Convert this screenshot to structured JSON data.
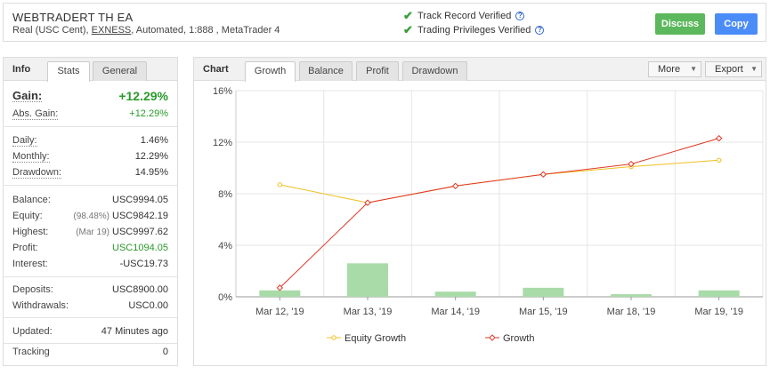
{
  "header": {
    "title": "WEBTRADERT TH EA",
    "subtitle_prefix": "Real (USC Cent), ",
    "broker": "EXNESS",
    "subtitle_suffix": ", Automated, 1:888 , MetaTrader 4",
    "verify1": "Track Record Verified",
    "verify2": "Trading Privileges Verified",
    "discuss_label": "Discuss",
    "copy_label": "Copy"
  },
  "left": {
    "title": "Info",
    "tabs": [
      "Stats",
      "General"
    ],
    "gain": {
      "label": "Gain:",
      "value": "+12.29%"
    },
    "abs_gain": {
      "label": "Abs. Gain:",
      "value": "+12.29%"
    },
    "daily": {
      "label": "Daily:",
      "value": "1.46%"
    },
    "monthly": {
      "label": "Monthly:",
      "value": "12.29%"
    },
    "drawdown": {
      "label": "Drawdown:",
      "value": "14.95%"
    },
    "balance": {
      "label": "Balance:",
      "value": "USC9994.05"
    },
    "equity": {
      "label": "Equity:",
      "note": "(98.48%)",
      "value": "USC9842.19"
    },
    "highest": {
      "label": "Highest:",
      "note": "(Mar 19)",
      "value": "USC9997.62"
    },
    "profit": {
      "label": "Profit:",
      "value": "USC1094.05"
    },
    "interest": {
      "label": "Interest:",
      "value": "-USC19.73"
    },
    "deposits": {
      "label": "Deposits:",
      "value": "USC8900.00"
    },
    "withdrawals": {
      "label": "Withdrawals:",
      "value": "USC0.00"
    },
    "updated": {
      "label": "Updated:",
      "value": "47 Minutes ago"
    },
    "tracking": {
      "label": "Tracking",
      "value": "0"
    }
  },
  "right": {
    "title": "Chart",
    "tabs": [
      "Growth",
      "Balance",
      "Profit",
      "Drawdown"
    ],
    "more_label": "More",
    "export_label": "Export"
  },
  "colors": {
    "equity_line": "#f0c020",
    "growth_line": "#e03a2a",
    "bars": "#a8dba8",
    "accent_green": "#2a9a2a",
    "discuss_btn": "#5cb85c",
    "copy_btn": "#4b8df8"
  },
  "chart_data": {
    "type": "line",
    "categories": [
      "Mar 12, '19",
      "Mar 13, '19",
      "Mar 14, '19",
      "Mar 15, '19",
      "Mar 18, '19",
      "Mar 19, '19"
    ],
    "series": [
      {
        "name": "Equity Growth",
        "values": [
          8.7,
          7.3,
          8.6,
          9.5,
          10.1,
          10.6
        ]
      },
      {
        "name": "Growth",
        "values": [
          0.7,
          7.3,
          8.6,
          9.5,
          10.3,
          12.3
        ]
      }
    ],
    "bars": [
      0.5,
      2.6,
      0.4,
      0.7,
      0.2,
      0.5
    ],
    "ylim": [
      0,
      16
    ],
    "yticks": [
      "0%",
      "4%",
      "8%",
      "12%",
      "16%"
    ],
    "grid": true,
    "legend": "bottom"
  }
}
